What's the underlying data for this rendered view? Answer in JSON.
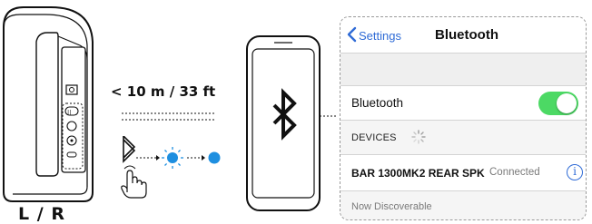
{
  "speaker": {
    "channel_label": "L / R"
  },
  "range": {
    "label": "< 10 m / 33 ft"
  },
  "settings": {
    "back_label": "Settings",
    "title": "Bluetooth",
    "bluetooth_label": "Bluetooth",
    "bluetooth_on": true,
    "devices_header": "DEVICES",
    "device": {
      "name": "BAR 1300MK2 REAR SPK",
      "status": "Connected",
      "info_glyph": "i"
    },
    "discoverable_label": "Now Discoverable"
  },
  "colors": {
    "accent_blue": "#2f6bd6",
    "led_blue": "#1e8fe0",
    "toggle_green": "#4cd964"
  },
  "icons": [
    "bluetooth-icon",
    "finger-press-icon",
    "blinking-led-icon",
    "solid-led-icon",
    "chevron-left-icon",
    "info-icon",
    "spinner-icon"
  ]
}
